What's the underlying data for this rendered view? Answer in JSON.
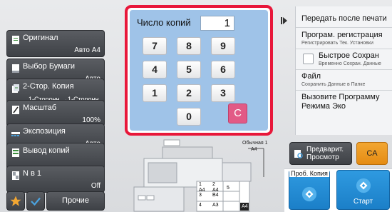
{
  "left_panel": {
    "items": [
      {
        "label": "Оригинал",
        "value": "Авто   A4",
        "icon": "original-icon"
      },
      {
        "label": "Выбор Бумаги",
        "value": "Авто",
        "icon": "paper-select-icon"
      },
      {
        "label": "2-Стор. Копия",
        "value": "1-Сторонн.→1-Сторонн.",
        "icon": "duplex-icon"
      },
      {
        "label": "Масштаб",
        "value": "100%",
        "icon": "zoom-icon"
      },
      {
        "label": "Экспозиция",
        "value": "Авто",
        "icon": "exposure-icon"
      },
      {
        "label": "Вывод копий",
        "value": "",
        "icon": "output-icon"
      },
      {
        "label": "N в 1",
        "value": "Off",
        "icon": "n-up-icon"
      }
    ],
    "other_label": "Прочие"
  },
  "keypad": {
    "label": "Число копий",
    "value": "1",
    "keys": [
      "7",
      "8",
      "9",
      "4",
      "5",
      "6",
      "1",
      "2",
      "3",
      "0"
    ],
    "clear": "C"
  },
  "right_panel": {
    "send_after_print": "Передать после печати",
    "program_registration": "Програм. регистрация",
    "program_registration_sub": "Регистрировать Тек. Установки",
    "quick_save": "Быстрое Сохран",
    "quick_save_sub": "Временно Сохран. Данные",
    "file": "Файл",
    "file_sub": "Сохранить Данные в Папке",
    "eco_program": "Вызовите Программу Режима Эко"
  },
  "preview": {
    "output_tray_label": "Обычная 1",
    "output_tray_paper": "A4",
    "trays": [
      {
        "num": "1",
        "size": "A4"
      },
      {
        "num": "2",
        "size": "A4"
      },
      {
        "num": "3",
        "size": "B4"
      },
      {
        "num": "4",
        "size": "A3"
      },
      {
        "num": "5",
        "size": ""
      }
    ],
    "bypass_size": "A4"
  },
  "actions": {
    "preview_label": "Предварит. Просмотр",
    "ca_label": "CA",
    "test_copy_label": "Проб. Копия",
    "start_label": "Старт"
  },
  "colors": {
    "highlight": "#e8173a",
    "keypad_bg": "#9fc3e8",
    "clear_key": "#e25a86",
    "ca_button": "#f2a632",
    "start_button": "#1b7fc8"
  }
}
